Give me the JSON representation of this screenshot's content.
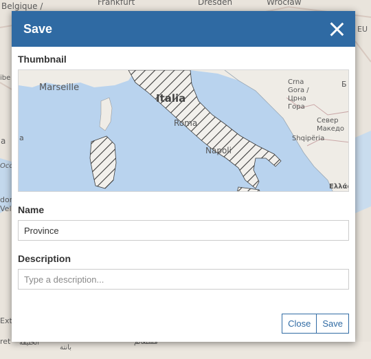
{
  "background": {
    "labels": [
      "Belgique /",
      "Frankfurt",
      "Dresden",
      "Wrocław",
      "EU",
      "ibe",
      "a",
      "Occi",
      "dorr",
      "Vella",
      "Ext",
      "ret",
      "بانتة",
      "الخليفة",
      "مستغانم"
    ]
  },
  "dialog": {
    "title": "Save",
    "thumbnail_label": "Thumbnail",
    "thumbnail_map_labels": {
      "marseille": "Marseille",
      "italia": "Italia",
      "roma": "Roma",
      "napoli": "Napoli",
      "crna_gora": "Crna\nGora /\nЦрна\nГора",
      "shqiperia": "Shqipëria",
      "severna": "Север\nМакедо",
      "ellas": "Ελλάς",
      "edge_a": "a",
      "edge_b": "Б"
    },
    "name_label": "Name",
    "name_value": "Province",
    "description_label": "Description",
    "description_placeholder": "Type a description...",
    "buttons": {
      "close": "Close",
      "save": "Save"
    }
  },
  "colors": {
    "header": "#2f6aa3",
    "sea": "#b9d3ee",
    "land": "#f2efe9",
    "hatch": "#3b3b3b"
  }
}
